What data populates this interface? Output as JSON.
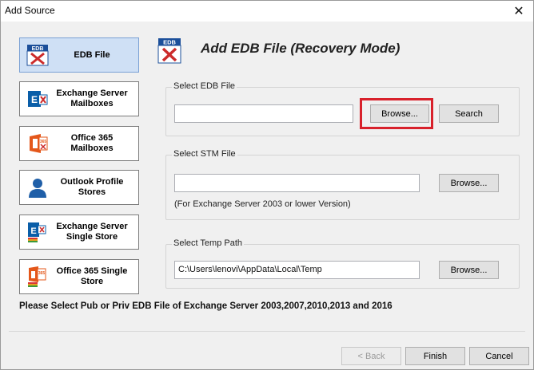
{
  "window": {
    "title": "Add Source",
    "close_glyph": "✕"
  },
  "sidebar": {
    "items": [
      {
        "label": "EDB File",
        "icon": "edb-icon",
        "active": true
      },
      {
        "label": "Exchange Server\nMailboxes",
        "icon": "exchange-icon",
        "active": false
      },
      {
        "label": "Office 365\nMailboxes",
        "icon": "office365-icon",
        "active": false
      },
      {
        "label": "Outlook Profile\nStores",
        "icon": "outlook-profile-icon",
        "active": false
      },
      {
        "label": "Exchange Server\nSingle Store",
        "icon": "exchange-single-store-icon",
        "active": false
      },
      {
        "label": "Office 365 Single\nStore",
        "icon": "office365-single-store-icon",
        "active": false
      }
    ]
  },
  "header": {
    "title": "Add EDB File (Recovery Mode)",
    "icon": "edb-icon"
  },
  "edb_group": {
    "legend": "Select EDB File",
    "value": "",
    "browse_label": "Browse...",
    "search_label": "Search"
  },
  "stm_group": {
    "legend": "Select STM File",
    "value": "",
    "browse_label": "Browse...",
    "note": "(For Exchange Server 2003 or lower Version)"
  },
  "temp_group": {
    "legend": "Select Temp Path",
    "value": "C:\\Users\\lenovi\\AppData\\Local\\Temp",
    "browse_label": "Browse..."
  },
  "footer_note": "Please Select Pub or Priv EDB File of Exchange Server 2003,2007,2010,2013 and 2016",
  "footer": {
    "back_label": "< Back",
    "finish_label": "Finish",
    "cancel_label": "Cancel"
  },
  "colors": {
    "highlight": "#d8212b",
    "active_nav": "#cfe0f5",
    "edb_red": "#cc2b2b",
    "office_orange": "#e4571a",
    "exchange_blue": "#0a5ea8"
  }
}
